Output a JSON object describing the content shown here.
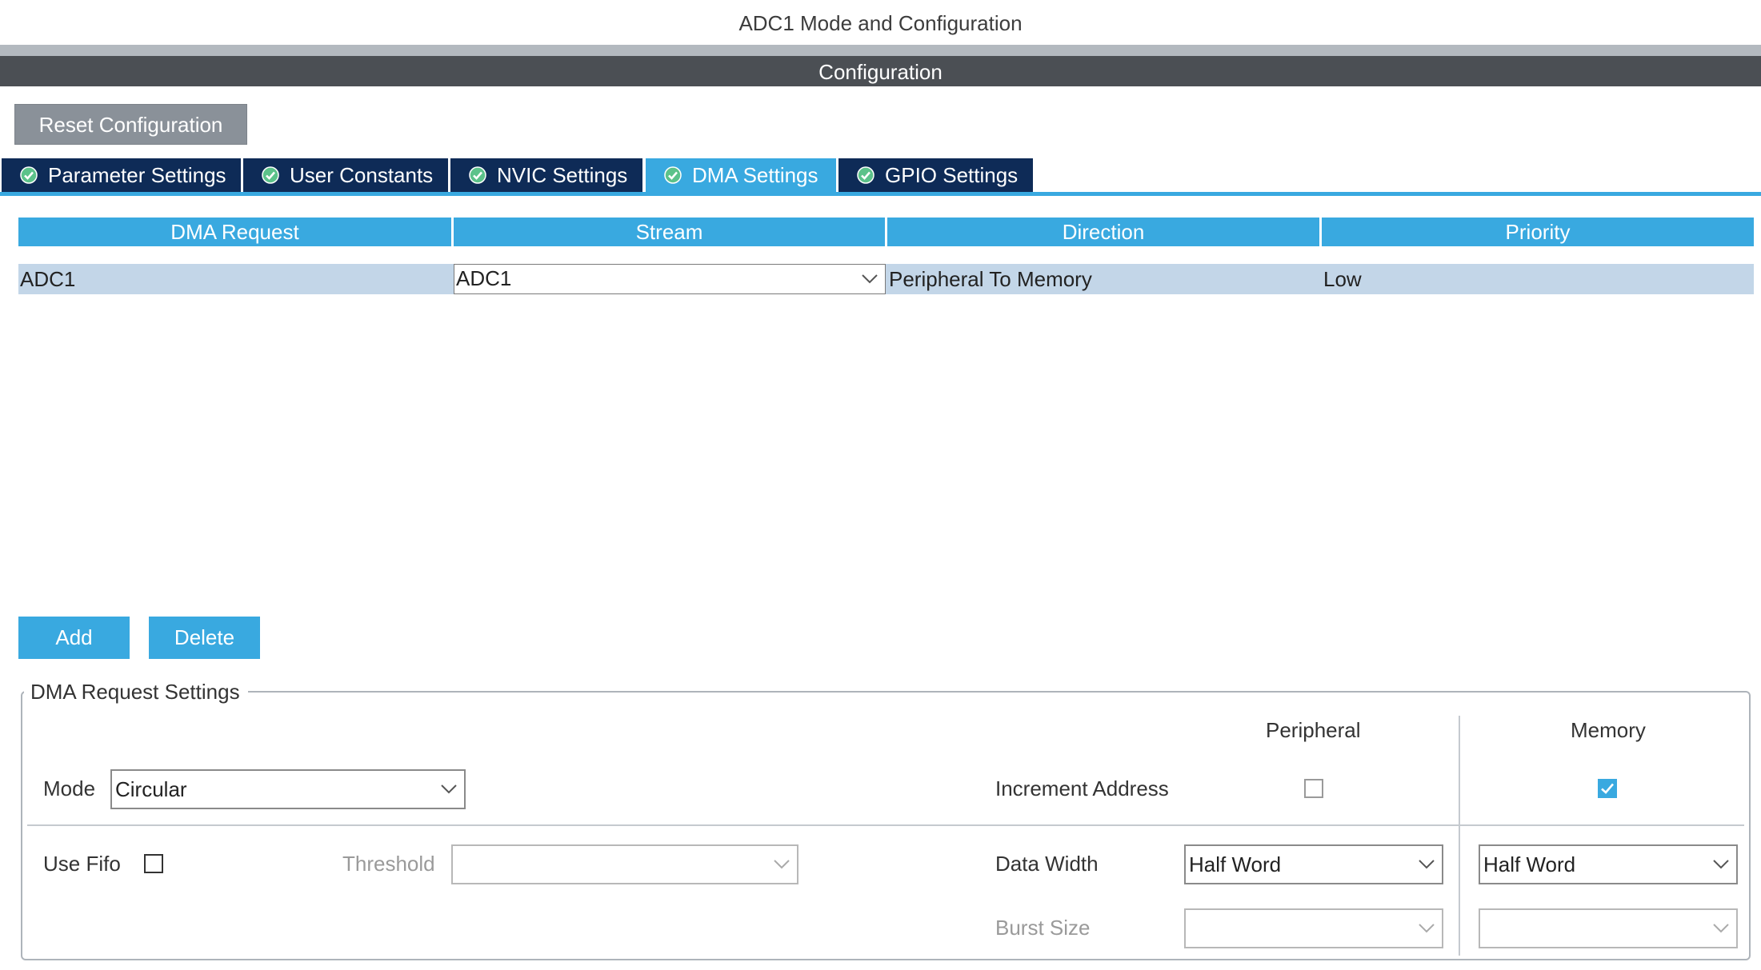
{
  "window": {
    "title": "ADC1 Mode and Configuration"
  },
  "config_header": "Configuration",
  "reset_button": "Reset Configuration",
  "tabs": [
    {
      "label": "Parameter Settings",
      "active": false
    },
    {
      "label": "User Constants",
      "active": false
    },
    {
      "label": "NVIC Settings",
      "active": false
    },
    {
      "label": "DMA Settings",
      "active": true
    },
    {
      "label": "GPIO Settings",
      "active": false
    }
  ],
  "table": {
    "headers": [
      "DMA Request",
      "Stream",
      "Direction",
      "Priority"
    ],
    "rows": [
      {
        "request": "ADC1",
        "stream": "ADC1",
        "direction": "Peripheral To Memory",
        "priority": "Low"
      }
    ]
  },
  "buttons": {
    "add": "Add",
    "delete": "Delete"
  },
  "request_settings": {
    "title": "DMA Request Settings",
    "col_peripheral": "Peripheral",
    "col_memory": "Memory",
    "mode_label": "Mode",
    "mode_value": "Circular",
    "increment_label": "Increment Address",
    "increment_peripheral": false,
    "increment_memory": true,
    "use_fifo_label": "Use Fifo",
    "use_fifo": false,
    "threshold_label": "Threshold",
    "threshold_value": "",
    "data_width_label": "Data Width",
    "data_width_peripheral": "Half Word",
    "data_width_memory": "Half Word",
    "burst_size_label": "Burst Size",
    "burst_peripheral": "",
    "burst_memory": ""
  },
  "colors": {
    "accent": "#39a9e0",
    "tab_dark": "#0e2b57",
    "header_bar": "#4b4f54",
    "row_selected": "#c3d6e8"
  }
}
